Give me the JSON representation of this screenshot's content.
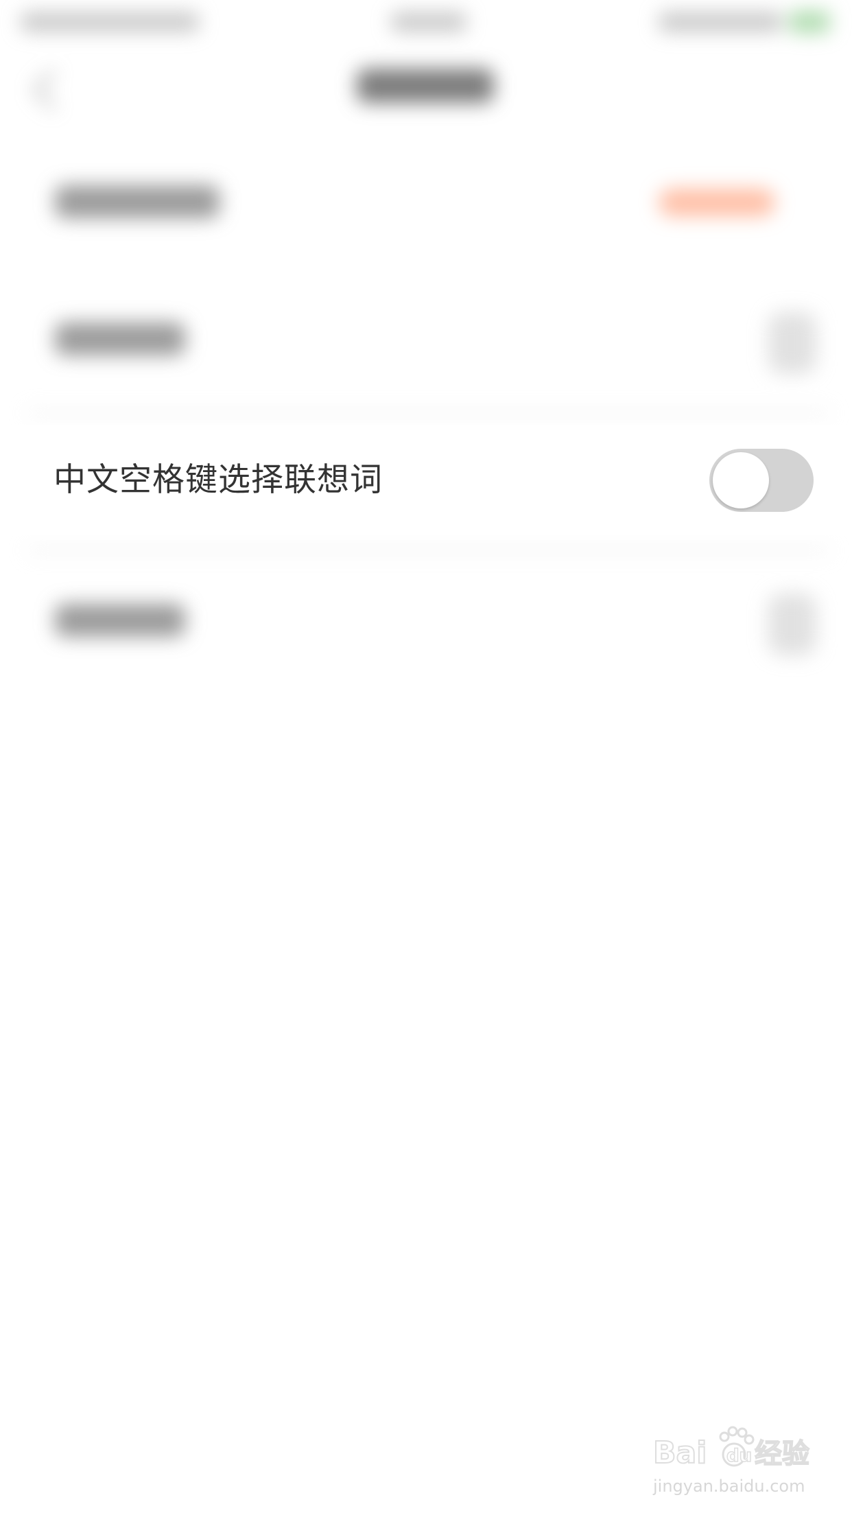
{
  "settings": {
    "space_key_row": {
      "label": "中文空格键选择联想词",
      "toggle_on": false
    }
  },
  "watermark": {
    "brand": "Bai du 经验",
    "url": "jingyan.baidu.com"
  },
  "colors": {
    "background": "#ffffff",
    "text": "#333333",
    "toggle_off_track": "#d3d3d3",
    "accent_blurred": "#ff8a5c",
    "battery_blurred": "#7bc47b"
  },
  "icons": {
    "back": "chevron-left-icon",
    "row_arrow": "chevron-right-icon"
  }
}
